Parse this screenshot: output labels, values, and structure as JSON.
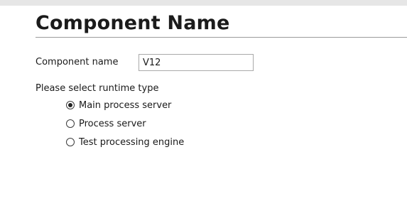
{
  "title": "Component Name",
  "component_name": {
    "label": "Component name",
    "value": "V12"
  },
  "runtime": {
    "label": "Please select runtime type",
    "options": [
      {
        "label": "Main process server",
        "selected": true
      },
      {
        "label": "Process server",
        "selected": false
      },
      {
        "label": "Test processing engine",
        "selected": false
      }
    ]
  }
}
